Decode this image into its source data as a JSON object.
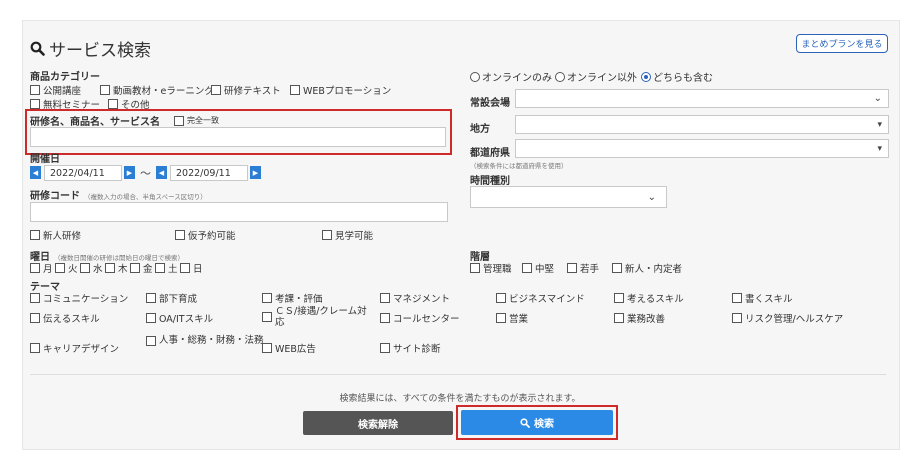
{
  "page": {
    "title": "サービス検索",
    "plan_button": "まとめプランを見る"
  },
  "category": {
    "label": "商品カテゴリー",
    "options": [
      "公開講座",
      "動画教材・eラーニング",
      "研修テキスト",
      "WEBプロモーション",
      "無料セミナー",
      "その他"
    ]
  },
  "keyword": {
    "label": "研修名、商品名、サービス名",
    "exact_match": "完全一致",
    "value": ""
  },
  "date": {
    "label": "開催日",
    "from": "2022/04/11",
    "separator": "～",
    "to": "2022/09/11"
  },
  "code": {
    "label": "研修コード",
    "hint": "（複数入力の場合、半角スペース区切り）",
    "value": ""
  },
  "flags": [
    "新人研修",
    "仮予約可能",
    "見学可能"
  ],
  "weekday": {
    "label": "曜日",
    "hint": "（複数日開催の研修は開始日の曜日で検索）",
    "days": [
      "月",
      "火",
      "水",
      "木",
      "金",
      "土",
      "日"
    ]
  },
  "theme": {
    "label": "テーマ",
    "items": [
      "コミュニケーション",
      "部下育成",
      "考課・評価",
      "マネジメント",
      "ビジネスマインド",
      "考えるスキル",
      "書くスキル",
      "伝えるスキル",
      "OA/ITスキル",
      "ＣＳ/接遇/クレーム対応",
      "コールセンター",
      "営業",
      "業務改善",
      "リスク管理/ヘルスケア",
      "キャリアデザイン",
      "人事・総務・財務・法務",
      "WEB広告",
      "サイト診断"
    ]
  },
  "online": {
    "options": [
      "オンラインのみ",
      "オンライン以外",
      "どちらも含む"
    ],
    "selected": "どちらも含む"
  },
  "venue": {
    "label": "常設会場",
    "value": ""
  },
  "region": {
    "label": "地方",
    "value": ""
  },
  "prefecture": {
    "label": "都道府県",
    "hint": "（検索条件には都道府県を使用）",
    "value": ""
  },
  "time_type": {
    "label": "時間種別",
    "value": ""
  },
  "level": {
    "label": "階層",
    "options": [
      "管理職",
      "中堅",
      "若手",
      "新人・内定者"
    ]
  },
  "footer": {
    "note": "検索結果には、すべての条件を満たすものが表示されます。",
    "clear_button": "検索解除",
    "search_button": "検索"
  },
  "colors": {
    "accent": "#2a8ae6",
    "highlight": "#cf2a2a",
    "clear": "#555555",
    "panel": "#f6f6f6"
  }
}
